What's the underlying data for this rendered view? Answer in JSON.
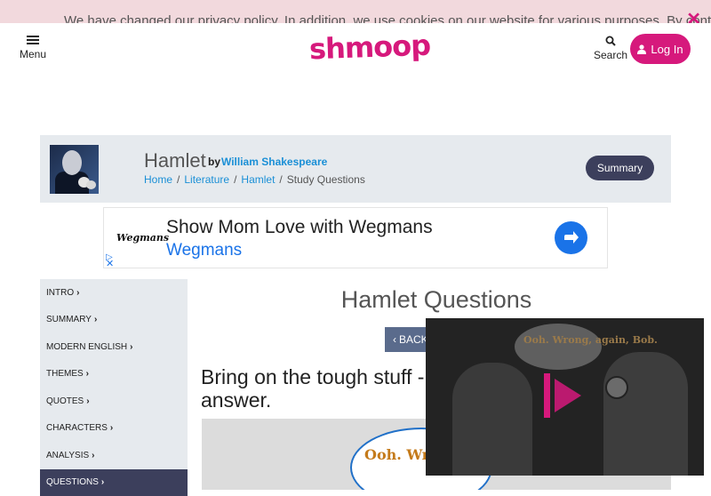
{
  "banner": {
    "text": "We have changed our privacy policy. In addition, we use cookies on our website for various purposes. By continuing on our",
    "close_glyph": "✕"
  },
  "header": {
    "menu_label": "Menu",
    "logo_text": "shmoop",
    "search_label": "Search",
    "login_label": "Log In",
    "brand_color": "#d6197c"
  },
  "book": {
    "title": "Hamlet",
    "by": "by",
    "author": "William Shakespeare",
    "breadcrumbs": [
      "Home",
      "Literature",
      "Hamlet",
      "Study Questions"
    ],
    "summary_label": "Summary"
  },
  "ad": {
    "logo": "Wegmans",
    "headline": "Show Mom Love with Wegmans",
    "brand": "Wegmans",
    "arrow_glyph": "▷",
    "close_glyph": "✕"
  },
  "sidebar": {
    "items": [
      {
        "label": "INTRO"
      },
      {
        "label": "SUMMARY"
      },
      {
        "label": "MODERN ENGLISH"
      },
      {
        "label": "THEMES"
      },
      {
        "label": "QUOTES"
      },
      {
        "label": "CHARACTERS"
      },
      {
        "label": "ANALYSIS"
      },
      {
        "label": "QUESTIONS"
      }
    ],
    "active": "QUESTIONS",
    "chevron": "›"
  },
  "main": {
    "heading": "Hamlet Questions",
    "back_label": "BACK",
    "intro_text": "Bring on the tough stuff - answer.",
    "cartoon_text": "Ooh. Wrong, again, Bob."
  },
  "video": {
    "bubble_text": "Ooh. Wrong, again, Bob."
  }
}
